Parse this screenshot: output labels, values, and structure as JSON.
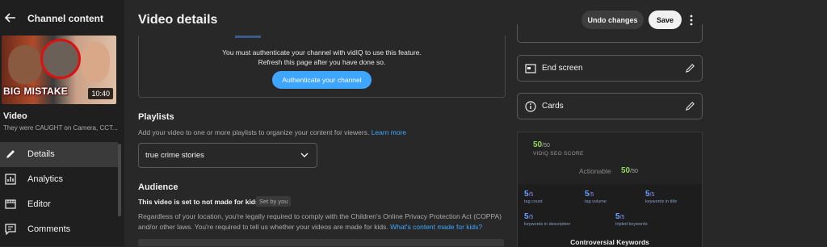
{
  "sidebar": {
    "title": "Channel content",
    "thumbnail": {
      "caption": "BIG MISTAKE",
      "duration": "10:40"
    },
    "video_label": "Video",
    "video_subtitle": "They were CAUGHT on Camera, CCT...",
    "nav": [
      {
        "label": "Details",
        "icon": "pencil-icon",
        "active": true
      },
      {
        "label": "Analytics",
        "icon": "analytics-icon"
      },
      {
        "label": "Editor",
        "icon": "editor-icon"
      },
      {
        "label": "Comments",
        "icon": "comments-icon"
      }
    ]
  },
  "header": {
    "title": "Video details",
    "undo_label": "Undo changes",
    "save_label": "Save"
  },
  "vidiq_auth": {
    "line1": "You must authenticate your channel with vidIQ to use this feature.",
    "line2": "Refresh this page after you have done so.",
    "button_label": "Authenticate your channel"
  },
  "playlists": {
    "title": "Playlists",
    "description": "Add your video to one or more playlists to organize your content for viewers.",
    "learn_more": "Learn more",
    "selected": "true crime stories"
  },
  "audience": {
    "title": "Audience",
    "status": "This video is set to not made for kids",
    "badge": "Set by you",
    "desc_line1": "Regardless of your location, you're legally required to comply with the Children's Online Privacy Protection Act (COPPA)",
    "desc_line2": "and/or other laws. You're required to tell us whether your videos are made for kids.",
    "link": "What's content made for kids?"
  },
  "right_panel": {
    "end_screen": "End screen",
    "cards": "Cards"
  },
  "seo": {
    "score": "50",
    "score_den": "/50",
    "label": "VIDIQ SEO SCORE",
    "actionable_label": "Actionable",
    "actionable_score": "50",
    "actionable_den": "/50",
    "metrics": [
      {
        "value": "5",
        "den": "/5",
        "label": "tag count"
      },
      {
        "value": "5",
        "den": "/5",
        "label": "tag volume"
      },
      {
        "value": "5",
        "den": "/5",
        "label": "keywords in title"
      },
      {
        "value": "5",
        "den": "/5",
        "label": "keywords in description"
      },
      {
        "value": "5",
        "den": "/5",
        "label": "tripled keywords"
      }
    ],
    "controversial_title": "Controversial Keywords"
  },
  "colors": {
    "background": "#282828",
    "sidebar": "#1f1f1f",
    "accent": "#3ea6ff",
    "score_green": "#8ed65a",
    "metric_blue": "#6aa0ff"
  }
}
